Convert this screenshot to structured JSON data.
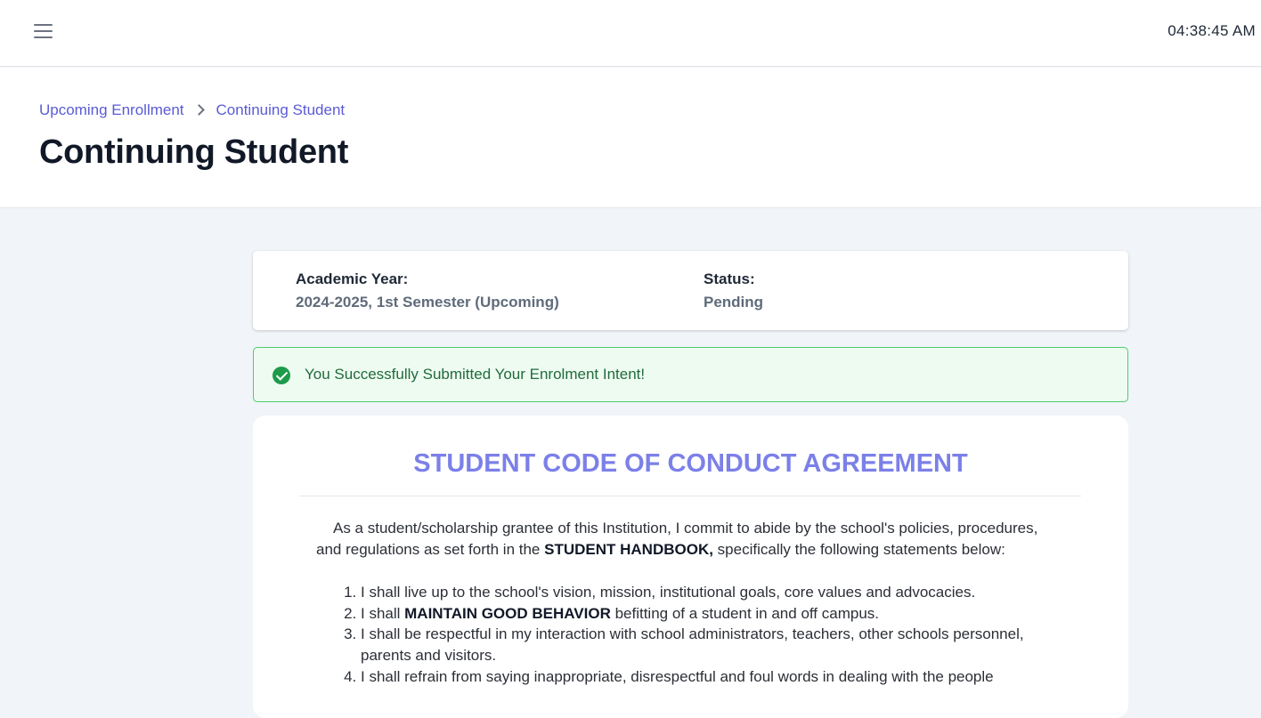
{
  "topbar": {
    "menu_icon": "hamburger-menu-icon",
    "clock": "04:38:45 AM"
  },
  "breadcrumb": {
    "items": [
      "Upcoming Enrollment",
      "Continuing Student"
    ]
  },
  "page": {
    "title": "Continuing Student"
  },
  "info": {
    "academic_year_label": "Academic Year:",
    "academic_year_value": "2024-2025, 1st Semester (Upcoming)",
    "status_label": "Status:",
    "status_value": "Pending"
  },
  "alert": {
    "icon": "check-circle-icon",
    "message": "You Successfully Submitted Your Enrolment Intent!",
    "color": "#1e9b4a"
  },
  "conduct": {
    "title": "STUDENT CODE OF CONDUCT AGREEMENT",
    "intro_1": "As a student/scholarship grantee of this Institution, I commit to abide by the school's policies, procedures,",
    "intro_2_pre": "and regulations as set forth in the ",
    "intro_2_bold": "STUDENT HANDBOOK,",
    "intro_2_post": " specifically the following statements below:",
    "rule_1": "I shall live up to the school's vision, mission, institutional goals, core values and advocacies.",
    "rule_2_pre": "I shall ",
    "rule_2_bold": "MAINTAIN GOOD BEHAVIOR",
    "rule_2_post": " befitting of a student in and off campus.",
    "rule_3": "I shall be respectful in my interaction with school administrators, teachers, other schools personnel, parents and visitors.",
    "rule_4": "I shall refrain from saying inappropriate, disrespectful and foul words in dealing with the people"
  },
  "colors": {
    "accent": "#5b5bd6",
    "title_accent": "#7b80e8",
    "success_border": "#4ccd6b"
  }
}
